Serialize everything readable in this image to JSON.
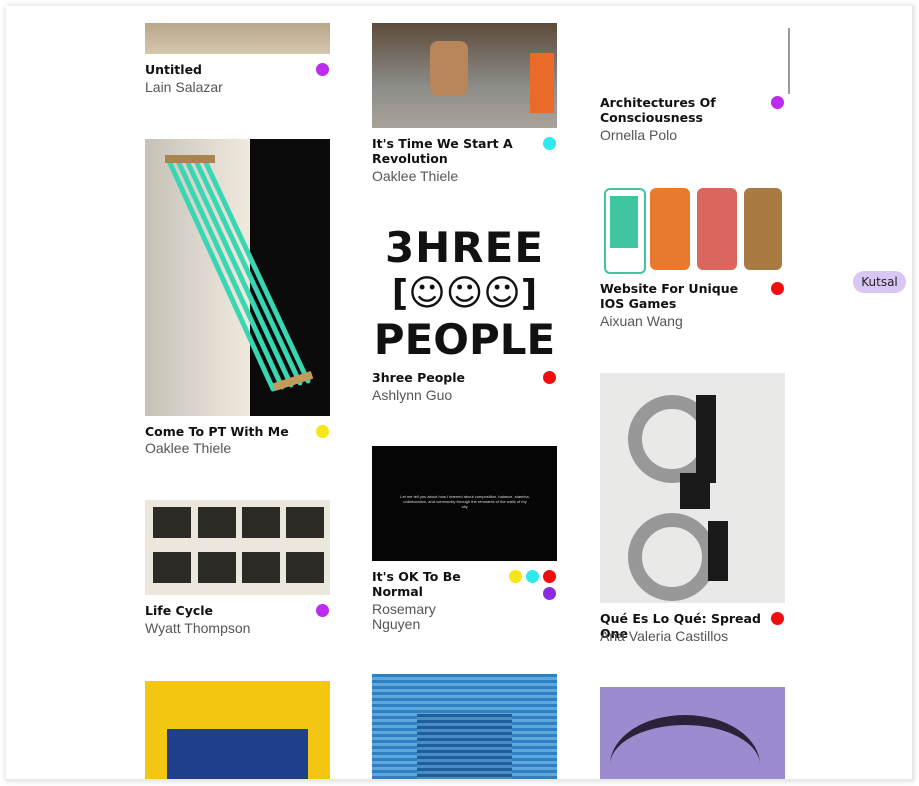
{
  "badge": "Kutsal",
  "cards": [
    {
      "title": "Untitled",
      "author": "Lain Salazar"
    },
    {
      "title": "Come To PT With Me",
      "author": "Oaklee Thiele"
    },
    {
      "title": "Life Cycle",
      "author": "Wyatt Thompson"
    },
    {
      "title": "It's Time We Start A Revolution",
      "author": "Oaklee Thiele"
    },
    {
      "title": "3hree People",
      "author": "Ashlynn Guo"
    },
    {
      "title": "It's OK To Be Normal",
      "author": "Rosemary Nguyen"
    },
    {
      "title": "Architectures Of Consciousness",
      "author": "Ornella Polo"
    },
    {
      "title": "Website For Unique IOS Games",
      "author": "Aixuan Wang"
    },
    {
      "title": "Qué Es Lo Qué: Spread One",
      "author": "Ana Valeria Castillos"
    }
  ],
  "dot_colors": {
    "purple": "#bb2bf0",
    "yellow": "#f5e617",
    "cyan": "#2ee8ee",
    "red": "#f00d0d",
    "violet": "#8a2be2"
  },
  "art_text": {
    "three_line1": "3HREE",
    "three_line3": "PEOPLE",
    "normal_caption": "Let me tell you about how I learned about composition, balance, stamina, collaboration, and community through the remnants of the walls of my city."
  }
}
